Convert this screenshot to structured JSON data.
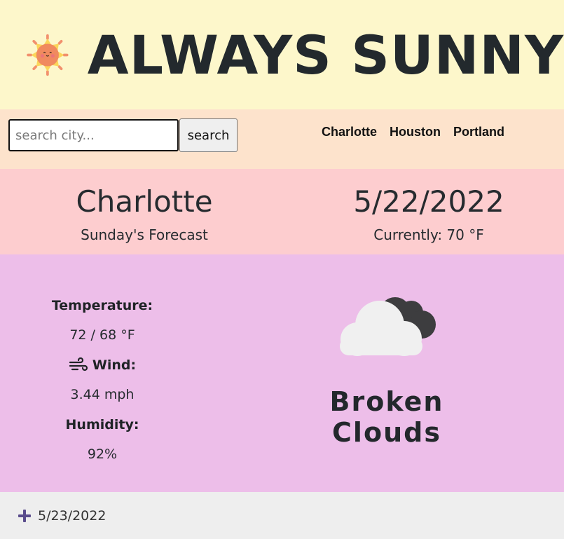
{
  "header": {
    "title": "ALWAYS SUNNY",
    "logo_icon": "sun-icon"
  },
  "search": {
    "placeholder": "search city...",
    "value": "",
    "button_label": "search"
  },
  "saved_cities": [
    "Charlotte",
    "Houston",
    "Portland"
  ],
  "overview": {
    "city": "Charlotte",
    "forecast_label": "Sunday's Forecast",
    "date": "5/22/2022",
    "current": "Currently: 70 °F"
  },
  "details": {
    "temperature_label": "Temperature:",
    "temperature_value": "72 / 68 °F",
    "wind_label": "Wind:",
    "wind_icon": "wind-icon",
    "wind_value": "3.44 mph",
    "humidity_label": "Humidity:",
    "humidity_value": "92%",
    "condition": "Broken Clouds",
    "condition_icon": "broken-clouds-icon"
  },
  "upcoming": [
    {
      "date": "5/23/2022",
      "icon": "plus-icon"
    }
  ],
  "colors": {
    "header_bg": "#fdf7cb",
    "search_bg": "#fde3cc",
    "overview_bg": "#fdcdcf",
    "details_bg": "#edbee9",
    "upcoming_bg": "#eeeeee",
    "accent_plus": "#5a4c8c"
  }
}
